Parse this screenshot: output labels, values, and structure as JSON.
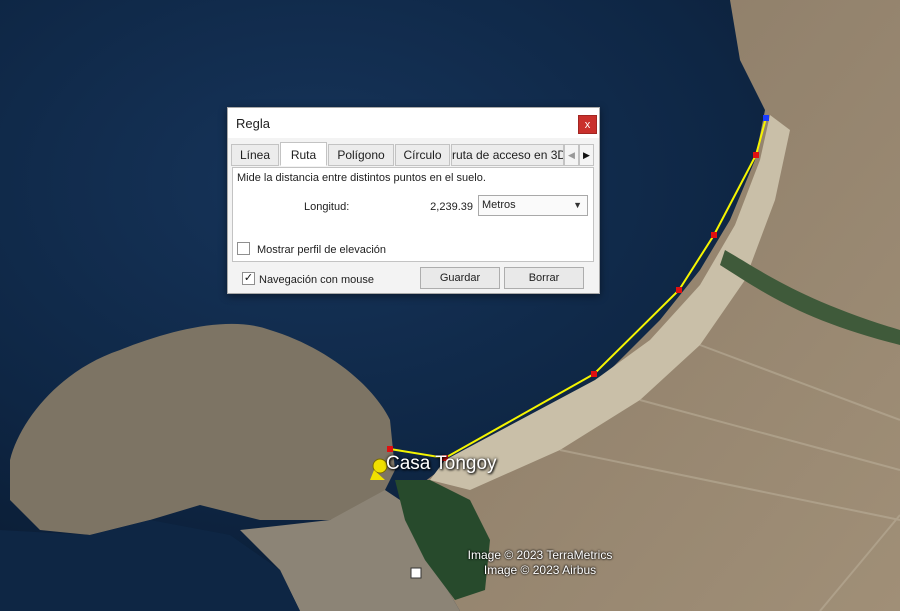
{
  "dialog": {
    "title": "Regla",
    "close_glyph": "x",
    "tabs": [
      {
        "label": "Línea",
        "active": false
      },
      {
        "label": "Ruta",
        "active": true
      },
      {
        "label": "Polígono",
        "active": false
      },
      {
        "label": "Círculo",
        "active": false
      },
      {
        "label": "ruta de acceso en 3D",
        "active": false
      }
    ],
    "tab_scroll_left_icon": "triangle-left",
    "tab_scroll_right_icon": "triangle-right",
    "description": "Mide la distancia entre distintos puntos en el suelo.",
    "length_label": "Longitud:",
    "length_value": "2,239.39",
    "unit_selected": "Metros",
    "elevation_profile_label": "Mostrar perfil de elevación",
    "elevation_profile_checked": false,
    "mouse_navigation_label": "Navegación con mouse",
    "mouse_navigation_checked": true,
    "check_glyph": "✓",
    "save_label": "Guardar",
    "clear_label": "Borrar"
  },
  "map": {
    "placemark_label": "Casa Tongoy",
    "credits": [
      "Image © 2023 TerraMetrics",
      "Image © 2023 Airbus"
    ],
    "route_color": "#f5f500",
    "vertex_color": "#e01010",
    "end_vertex_color": "#1a3cff"
  }
}
